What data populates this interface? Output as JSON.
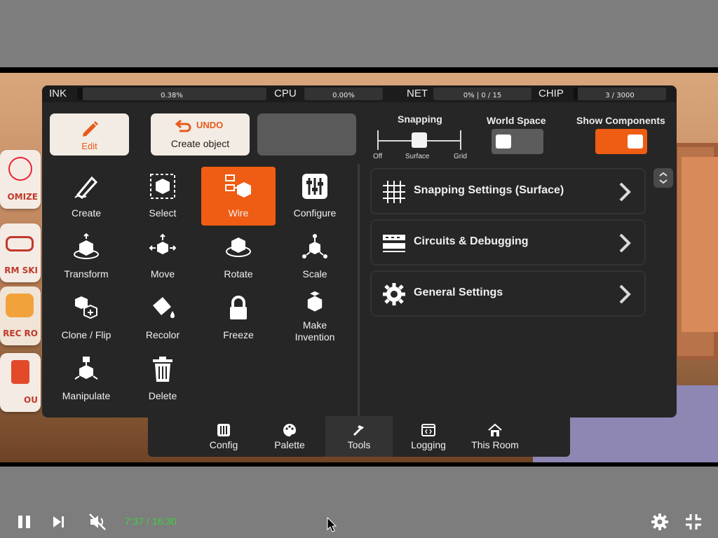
{
  "status": {
    "ink_label": "INK",
    "ink_value": "0.38%",
    "ink_fill": 0.0038,
    "cpu_label": "CPU",
    "cpu_value": "0.00%",
    "cpu_fill": 0,
    "net_label": "NET",
    "net_value": "0% | 0 / 15",
    "net_fill": 0,
    "chip_label": "CHIP",
    "chip_value": "3 / 3000",
    "chip_fill": 0.001
  },
  "toolbar": {
    "edit_label": "Edit",
    "undo_label": "UNDO",
    "undo_desc": "Create object"
  },
  "snapping": {
    "title": "Snapping",
    "options": [
      "Off",
      "Surface",
      "Grid"
    ],
    "selected": "Surface"
  },
  "world_space": {
    "title": "World Space",
    "on": false,
    "color_off": "#5c5c5c"
  },
  "show_components": {
    "title": "Show Components",
    "on": true,
    "color_on": "#ef5c13"
  },
  "tools": [
    {
      "label": "Create",
      "icon": "pencil-create-icon"
    },
    {
      "label": "Select",
      "icon": "select-cube-icon"
    },
    {
      "label": "Wire",
      "icon": "wire-icon",
      "active": true
    },
    {
      "label": "Configure",
      "icon": "sliders-icon"
    },
    {
      "label": "Transform",
      "icon": "transform-icon"
    },
    {
      "label": "Move",
      "icon": "move-icon"
    },
    {
      "label": "Rotate",
      "icon": "rotate-icon"
    },
    {
      "label": "Scale",
      "icon": "scale-icon"
    },
    {
      "label": "Clone / Flip",
      "icon": "clone-icon"
    },
    {
      "label": "Recolor",
      "icon": "paint-bucket-icon"
    },
    {
      "label": "Freeze",
      "icon": "lock-icon"
    },
    {
      "label": "Make\nInvention",
      "icon": "invention-box-icon"
    },
    {
      "label": "Manipulate",
      "icon": "manipulate-icon"
    },
    {
      "label": "Delete",
      "icon": "trash-icon"
    }
  ],
  "settings": [
    {
      "label": "Snapping Settings (Surface)",
      "icon": "grid-icon"
    },
    {
      "label": "Circuits & Debugging",
      "icon": "circuit-icon"
    },
    {
      "label": "General Settings",
      "icon": "gear-icon"
    }
  ],
  "tabs": [
    {
      "label": "Config",
      "icon": "config-icon"
    },
    {
      "label": "Palette",
      "icon": "palette-icon"
    },
    {
      "label": "Tools",
      "icon": "tools-icon",
      "active": true
    },
    {
      "label": "Logging",
      "icon": "logging-icon"
    },
    {
      "label": "This Room",
      "icon": "home-icon"
    }
  ],
  "side_cards": [
    "OMIZE",
    "RM SKI",
    "REC RO",
    "OU"
  ],
  "player": {
    "time": "7:37 / 16:30",
    "accent": "#3fd23f"
  }
}
